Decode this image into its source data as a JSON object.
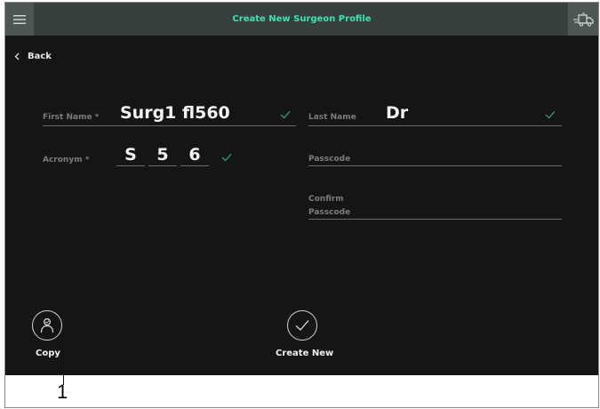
{
  "header": {
    "title": "Create New Surgeon Profile",
    "menu_icon": "hamburger-menu-icon",
    "right_icon": "truck-transfer-icon"
  },
  "nav": {
    "back_label": "Back",
    "back_icon": "chevron-left-icon"
  },
  "form": {
    "first_name": {
      "label": "First Name *",
      "value": "Surg1 fl560"
    },
    "last_name": {
      "label": "Last Name",
      "value": "Dr"
    },
    "acronym": {
      "label": "Acronym *",
      "letters": [
        "S",
        "5",
        "6"
      ]
    },
    "passcode": {
      "label": "Passcode",
      "value": ""
    },
    "confirm_passcode": {
      "label_line1": "Confirm",
      "label_line2": "Passcode",
      "value": ""
    }
  },
  "actions": {
    "copy": {
      "label": "Copy",
      "icon": "user-copy-icon"
    },
    "create_new": {
      "label": "Create New",
      "icon": "checkmark-circle-icon"
    }
  },
  "callout": {
    "number": "1"
  },
  "colors": {
    "accent": "#3fe3b2",
    "titlebar": "#36413f",
    "background": "#151515",
    "check": "#3aa67c"
  }
}
